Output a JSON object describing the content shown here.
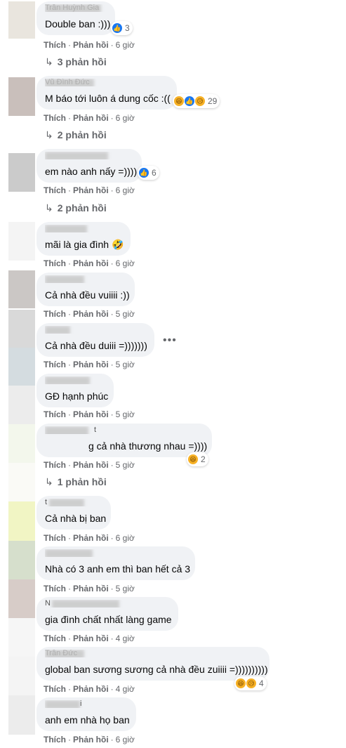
{
  "comments": [
    {
      "text": "Double ban :)))",
      "time": "6 giờ",
      "reaction_count": "3",
      "replies": "3 phản hồi",
      "name_hint": "Trần Huỳnh Gia"
    },
    {
      "text": "M báo tới luôn á dung cốc :((",
      "time": "6 giờ",
      "reaction_count": "29",
      "replies": "2 phản hồi",
      "name_hint": "Vũ Đình Đức"
    },
    {
      "text": "em nào anh nấy =))))",
      "time": "6 giờ",
      "reaction_count": "6",
      "replies": "2 phản hồi"
    },
    {
      "text": "mãi là gia đình",
      "emoji": "🤣",
      "time": "6 giờ"
    },
    {
      "text": "Cả nhà đều vuiiii :))",
      "time": "5 giờ"
    },
    {
      "text": "Cả nhà đều duiii =)))))))",
      "time": "5 giờ",
      "more": "•••"
    },
    {
      "text": "GĐ hạnh phúc",
      "time": "5 giờ"
    },
    {
      "text": "g cả nhà thương nhau =))))",
      "time": "5 giờ",
      "reaction_count": "2",
      "replies": "1 phản hồi",
      "name_hint": "t"
    },
    {
      "text": "Cả nhà bị ban",
      "time": "6 giờ"
    },
    {
      "text": "Nhà có 3 anh em thì ban hết cả 3",
      "time": "5 giờ"
    },
    {
      "text": "gia đình chất nhất làng game",
      "time": "4 giờ",
      "name_hint": "N"
    },
    {
      "text": "global ban sương sương cả nhà đều zuiiii =))))))))))",
      "time": "4 giờ",
      "reaction_count": "4",
      "name_hint": "Trần Đức"
    },
    {
      "text": "anh em nhà họ ban",
      "time": "6 giờ",
      "name_hint": "i"
    }
  ],
  "labels": {
    "like": "Thích",
    "reply": "Phản hồi",
    "separator": "·"
  },
  "colors": {
    "bubble": "#f0f2f5",
    "meta": "#65676b",
    "like_blue": "#1877f2",
    "haha_yellow": "#f7b125"
  }
}
